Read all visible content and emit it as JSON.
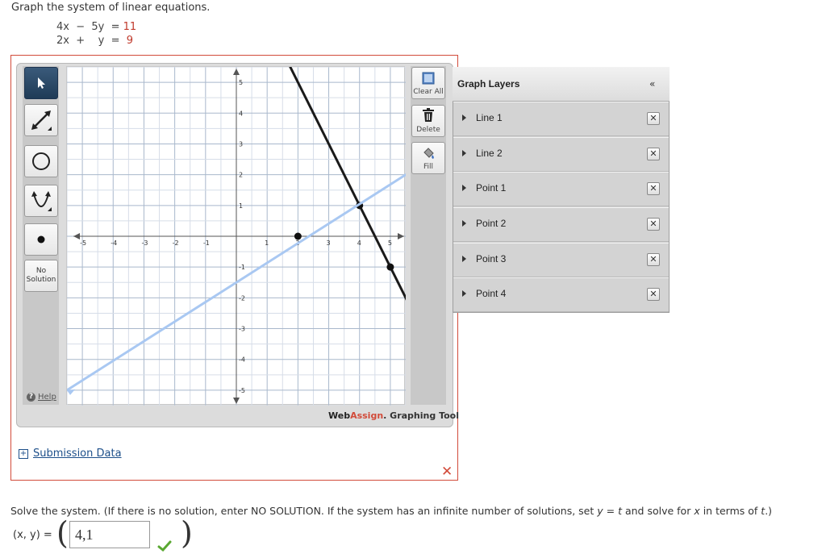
{
  "question": "Graph the system of linear equations.",
  "equations": [
    {
      "lhs": "4x  −  5y  =",
      "rhs": "11"
    },
    {
      "lhs": "2x  +    y  =",
      "rhs": "9"
    }
  ],
  "tools": {
    "no_solution_line1": "No",
    "no_solution_line2": "Solution",
    "help": "Help"
  },
  "actions": {
    "clear_all": "Clear All",
    "delete": "Delete",
    "fill": "Fill"
  },
  "brand": {
    "web": "Web",
    "assign": "Assign",
    "rest": ". Graphing Tool"
  },
  "layers": {
    "title": "Graph Layers",
    "collapse": "«",
    "items": [
      "Line 1",
      "Line 2",
      "Point 1",
      "Point 2",
      "Point 3",
      "Point 4"
    ]
  },
  "submission": "Submission Data",
  "solve_text": {
    "part1": "Solve the system. (If there is no solution, enter NO SOLUTION. If the system has an infinite number of solutions, set ",
    "y_eq_t": "y = t",
    "part2": " and solve for ",
    "x": "x",
    "part3": " in terms of ",
    "t": "t",
    "part4": ".)"
  },
  "answer": {
    "label": "(x, y) =",
    "value": "4,1"
  },
  "colors": {
    "accent_red": "#d24b3a",
    "line_dark": "#1a1a1a",
    "line_light": "#a9c8f2",
    "grid": "#a9b8cc"
  },
  "chart_data": {
    "type": "line",
    "xlim": [
      -5.5,
      5.5
    ],
    "ylim": [
      -5.5,
      5.5
    ],
    "grid": true,
    "x_ticks": [
      -5,
      -4,
      -3,
      -2,
      -1,
      1,
      2,
      3,
      4,
      5
    ],
    "y_ticks": [
      -5,
      -4,
      -3,
      -2,
      -1,
      1,
      2,
      3,
      4,
      5
    ],
    "series": [
      {
        "style": "solid-dark",
        "points": [
          [
            1.7,
            5.6
          ],
          [
            5.55,
            -2.1
          ]
        ],
        "markers": [
          [
            4,
            1
          ],
          [
            5,
            -1
          ]
        ]
      },
      {
        "style": "faint-blue",
        "points": [
          [
            -5.5,
            -5
          ],
          [
            5.5,
            2
          ]
        ],
        "markers": [
          [
            2,
            0
          ]
        ]
      }
    ]
  }
}
